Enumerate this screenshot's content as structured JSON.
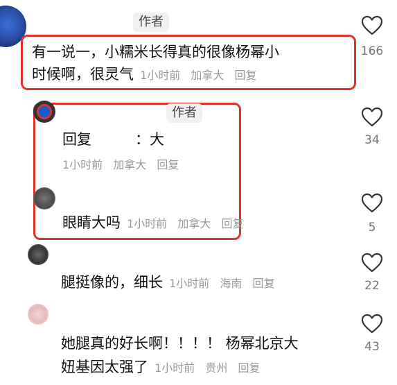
{
  "comments": [
    {
      "author_tag": "作者",
      "text": "有一说一，小糯米长得真的很像杨幂小时候啊，很灵气",
      "line1": "有一说一，小糯米长得真的很像杨幂小",
      "line2": "时候啊，很灵气",
      "time": "1小时前",
      "location": "加拿大",
      "reply": "回复",
      "likes": "166"
    },
    {
      "author_tag": "作者",
      "text": "回复　　　：大",
      "time": "1小时前",
      "location": "加拿大",
      "reply": "回复",
      "likes": "34"
    },
    {
      "text": "眼睛大吗",
      "time": "1小时前",
      "location": "加拿大",
      "reply": "回复",
      "likes": "5"
    },
    {
      "text": "腿挺像的，细长",
      "time": "1小时前",
      "location": "海南",
      "reply": "回复",
      "likes": "22"
    },
    {
      "text": "她腿真的好长啊！！！！ 杨幂北京大妞基因太强了",
      "line1": "她腿真的好长啊！！！！ 杨幂北京大",
      "line2": "妞基因太强了",
      "time": "1小时前",
      "location": "贵州",
      "reply": "回复",
      "likes": "43"
    }
  ],
  "icons": {
    "like": "heart-outline-icon"
  },
  "colors": {
    "highlight_border": "#e2302a",
    "meta_text": "#9a9a9a",
    "tag_bg": "#f1f1f3"
  }
}
